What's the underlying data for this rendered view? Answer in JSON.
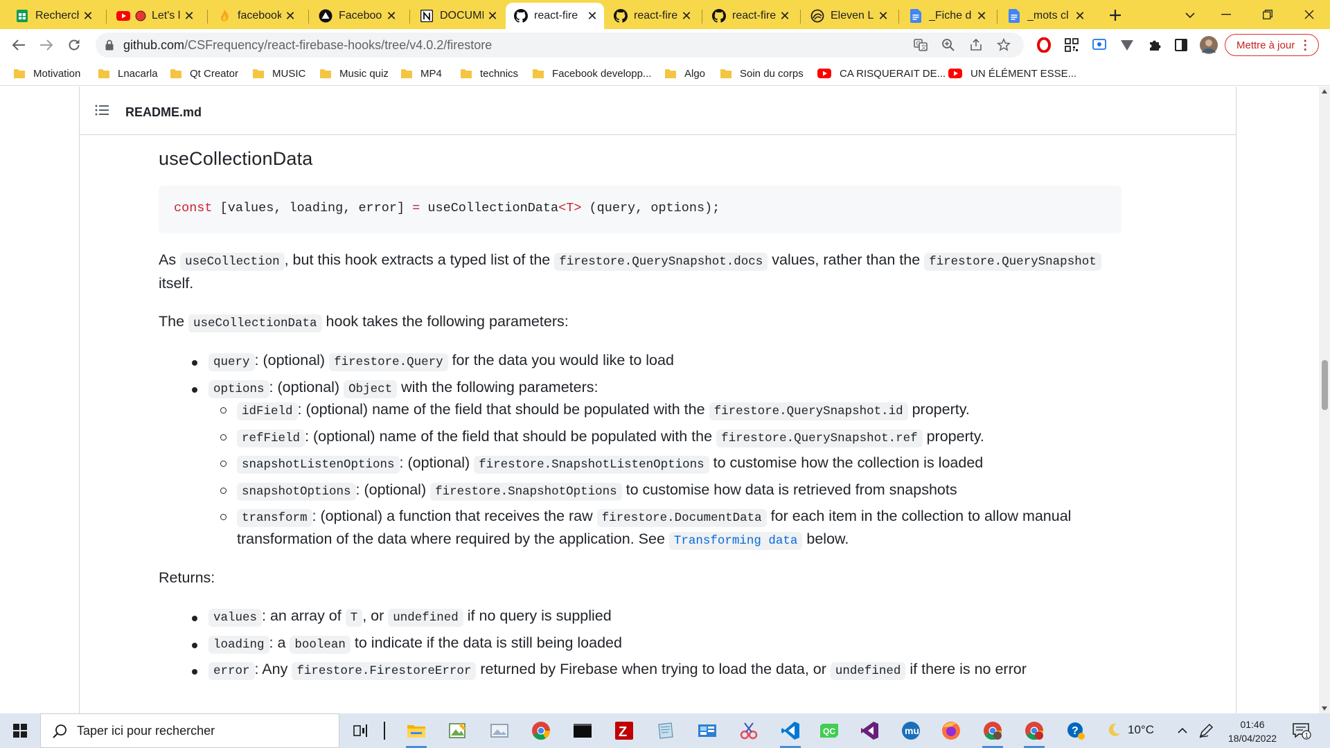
{
  "browser": {
    "tabs": [
      {
        "icon": "google-sheets-icon",
        "title": "Recherch"
      },
      {
        "icon": "youtube-icon",
        "title": "Let's l"
      },
      {
        "icon": "facebook-flame-icon",
        "title": "facebook"
      },
      {
        "icon": "vercel-icon",
        "title": "Facebook"
      },
      {
        "icon": "notion-icon",
        "title": "DOCUME"
      },
      {
        "icon": "github-icon",
        "title": "react-fire"
      },
      {
        "icon": "github-icon",
        "title": "react-fire"
      },
      {
        "icon": "github-icon",
        "title": "react-fire"
      },
      {
        "icon": "elevenlabs-icon",
        "title": "Eleven La"
      },
      {
        "icon": "google-docs-icon",
        "title": "_Fiche d"
      },
      {
        "icon": "google-docs-icon",
        "title": "_mots cl"
      }
    ],
    "active_tab_index": 5,
    "url_host": "github.com",
    "url_path": "/CSFrequency/react-firebase-hooks/tree/v4.0.2/firestore",
    "update_button": "Mettre à jour",
    "bookmarks": [
      {
        "icon": "folder-icon",
        "label": "Motivation"
      },
      {
        "icon": "folder-icon",
        "label": "Lnacarla"
      },
      {
        "icon": "folder-icon",
        "label": "Qt Creator"
      },
      {
        "icon": "folder-icon",
        "label": "MUSIC"
      },
      {
        "icon": "folder-icon",
        "label": "Music quiz"
      },
      {
        "icon": "folder-icon",
        "label": "MP4"
      },
      {
        "icon": "folder-icon",
        "label": "technics"
      },
      {
        "icon": "folder-icon",
        "label": "Facebook developp..."
      },
      {
        "icon": "folder-icon",
        "label": "Algo"
      },
      {
        "icon": "folder-icon",
        "label": "Soin du corps"
      },
      {
        "icon": "youtube-icon",
        "label": "CA RISQUERAIT DE..."
      },
      {
        "icon": "youtube-icon",
        "label": "UN ÉLÉMENT ESSE..."
      }
    ]
  },
  "readme": {
    "filename": "README.md",
    "heading": "useCollectionData",
    "code": {
      "kw": "const",
      "part1": " [values, loading, error] ",
      "eq": "=",
      "part2": " useCollectionData",
      "generic": "<T>",
      "part3": " (query, options);"
    },
    "intro": {
      "t1": "As ",
      "c1": "useCollection",
      "t2": ", but this hook extracts a typed list of the ",
      "c2": "firestore.QuerySnapshot.docs",
      "t3": " values, rather than the ",
      "c3": "firestore.QuerySnapshot",
      "t4": "itself."
    },
    "params_intro": {
      "t1": "The ",
      "c1": "useCollectionData",
      "t2": " hook takes the following parameters:"
    },
    "params": [
      {
        "code": "query",
        "t1": ": (optional) ",
        "code2": "firestore.Query",
        "t2": " for the data you would like to load"
      },
      {
        "code": "options",
        "t1": ": (optional) ",
        "code2": "Object",
        "t2": " with the following parameters:"
      }
    ],
    "options": [
      {
        "code": "idField",
        "t1": ": (optional) name of the field that should be populated with the ",
        "code2": "firestore.QuerySnapshot.id",
        "t2": " property."
      },
      {
        "code": "refField",
        "t1": ": (optional) name of the field that should be populated with the ",
        "code2": "firestore.QuerySnapshot.ref",
        "t2": " property."
      },
      {
        "code": "snapshotListenOptions",
        "t1": ": (optional) ",
        "code2": "firestore.SnapshotListenOptions",
        "t2": " to customise how the collection is loaded"
      },
      {
        "code": "snapshotOptions",
        "t1": ": (optional) ",
        "code2": "firestore.SnapshotOptions",
        "t2": " to customise how data is retrieved from snapshots"
      },
      {
        "code": "transform",
        "t1": ": (optional) a function that receives the raw ",
        "code2": "firestore.DocumentData",
        "t2": " for each item in the collection to allow manual",
        "line2": "transformation of the data where required by the application. See ",
        "link": "Transforming data",
        "t3": " below."
      }
    ],
    "returns_label": "Returns:",
    "returns": [
      {
        "code": "values",
        "t1": ": an array of ",
        "code2": "T",
        "t2": ", or ",
        "code3": "undefined",
        "t3": " if no query is supplied"
      },
      {
        "code": "loading",
        "t1": ": a ",
        "code2": "boolean",
        "t2": " to indicate if the data is still being loaded"
      },
      {
        "code": "error",
        "t1": ": Any ",
        "code2": "firestore.FirestoreError",
        "t2": " returned by Firebase when trying to load the data, or ",
        "code3": "undefined",
        "t3": " if there is no error"
      }
    ]
  },
  "taskbar": {
    "search_placeholder": "Taper ici pour rechercher",
    "temperature": "10°C",
    "time": "01:46",
    "date": "18/04/2022",
    "notification_count": "1"
  },
  "colors": {
    "tabstrip": "#f7d84b",
    "link": "#0969da",
    "keyword": "#cf222e"
  }
}
